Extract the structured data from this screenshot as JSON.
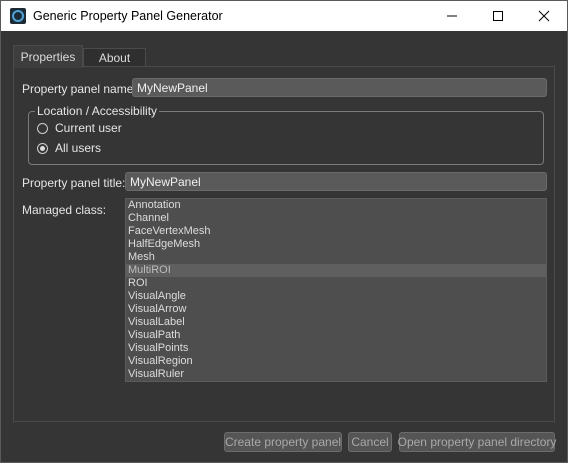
{
  "window": {
    "title": "Generic Property Panel Generator"
  },
  "tabs": [
    {
      "label": "Properties",
      "active": true
    },
    {
      "label": "About",
      "active": false
    }
  ],
  "form": {
    "panel_name_label": "Property panel name:",
    "panel_name_value": "MyNewPanel",
    "location_group_title": "Location / Accessibility",
    "radio_current_user": "Current user",
    "radio_all_users": "All users",
    "selected_location": "All users",
    "panel_title_label": "Property panel title:",
    "panel_title_value": "MyNewPanel",
    "managed_class_label": "Managed class:"
  },
  "managed_classes": [
    "Annotation",
    "Channel",
    "FaceVertexMesh",
    "HalfEdgeMesh",
    "Mesh",
    "MultiROI",
    "ROI",
    "VisualAngle",
    "VisualArrow",
    "VisualLabel",
    "VisualPath",
    "VisualPoints",
    "VisualRegion",
    "VisualRuler"
  ],
  "selected_class": "MultiROI",
  "buttons": {
    "create": "Create property panel",
    "cancel": "Cancel",
    "open_dir": "Open property panel directory"
  },
  "colors": {
    "background": "#353535",
    "titlebar": "#ffffff",
    "input_bg": "#5a5a5a",
    "list_bg": "#4e4e4e"
  }
}
